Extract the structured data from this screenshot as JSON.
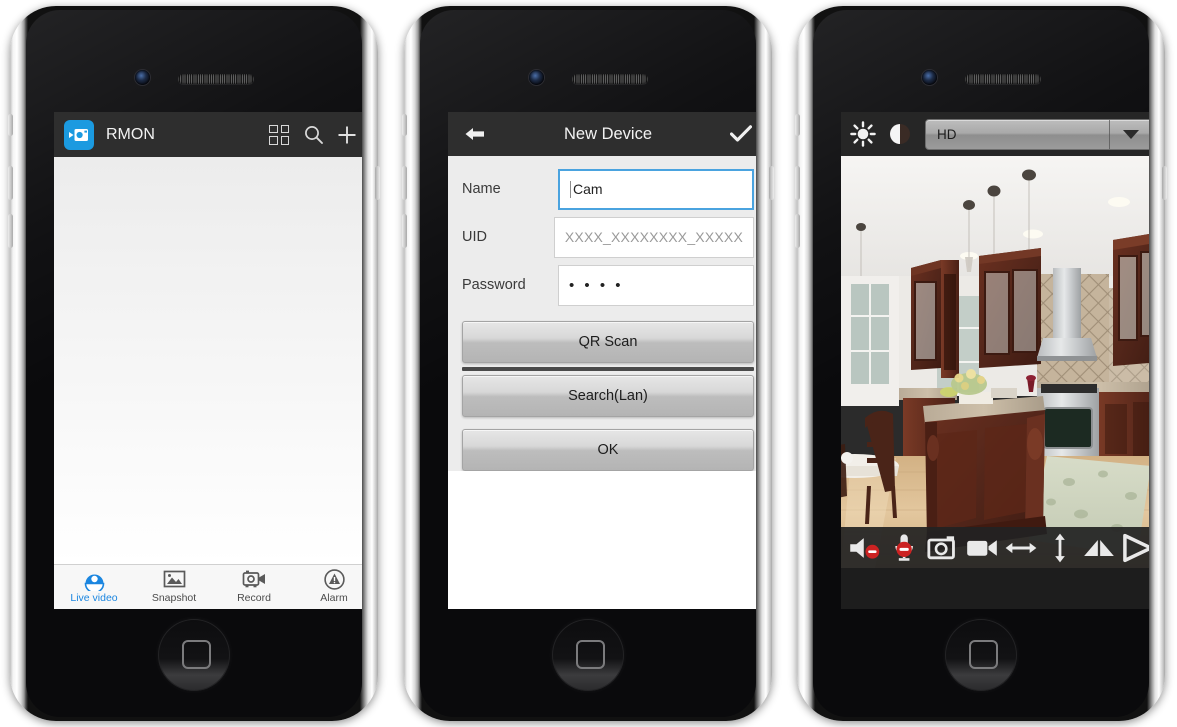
{
  "phone1": {
    "appbar": {
      "app_icon": "camera-app-icon",
      "title": "RMON",
      "grid_icon": "grid-view-icon",
      "search_icon": "search-icon",
      "add_icon": "plus-icon"
    },
    "device_list": {
      "items": []
    },
    "tabs": [
      {
        "label": "Live video",
        "icon": "live-video-icon",
        "active": true
      },
      {
        "label": "Snapshot",
        "icon": "snapshot-icon",
        "active": false
      },
      {
        "label": "Record",
        "icon": "record-icon",
        "active": false
      },
      {
        "label": "Alarm",
        "icon": "alarm-icon",
        "active": false
      }
    ],
    "accent_color": "#1b86e0"
  },
  "phone2": {
    "navbar": {
      "back_icon": "back-arrow-icon",
      "title": "New Device",
      "confirm_icon": "check-icon"
    },
    "fields": [
      {
        "label": "Name",
        "value": "Cam",
        "placeholder": "",
        "focused": true
      },
      {
        "label": "UID",
        "value": "",
        "placeholder": "XXXX_XXXXXXXX_XXXXX",
        "focused": false
      },
      {
        "label": "Password",
        "value": "• • • •",
        "placeholder": "",
        "focused": false
      }
    ],
    "buttons": [
      {
        "label": "QR Scan"
      },
      {
        "label": "Search(Lan)"
      },
      {
        "label": "OK"
      }
    ],
    "focus_color": "#4aa3df"
  },
  "phone3": {
    "toolbar_top": {
      "brightness_icon": "brightness-icon",
      "contrast_icon": "contrast-icon",
      "quality_value": "HD",
      "quality_options": [
        "HD"
      ],
      "dropdown_icon": "chevron-down-icon"
    },
    "video": {
      "scene": "kitchen-interior-live-feed"
    },
    "toolbar_bottom": [
      {
        "icon": "speaker-muted-icon",
        "badge": "muted"
      },
      {
        "icon": "microphone-muted-icon",
        "badge": "muted"
      },
      {
        "icon": "snapshot-camera-icon",
        "badge": ""
      },
      {
        "icon": "record-video-icon",
        "badge": ""
      },
      {
        "icon": "flip-horizontal-icon",
        "badge": ""
      },
      {
        "icon": "flip-vertical-icon",
        "badge": ""
      },
      {
        "icon": "mirror-icon",
        "badge": ""
      },
      {
        "icon": "play-icon",
        "badge": ""
      }
    ],
    "badge_color": "#cc2222"
  }
}
